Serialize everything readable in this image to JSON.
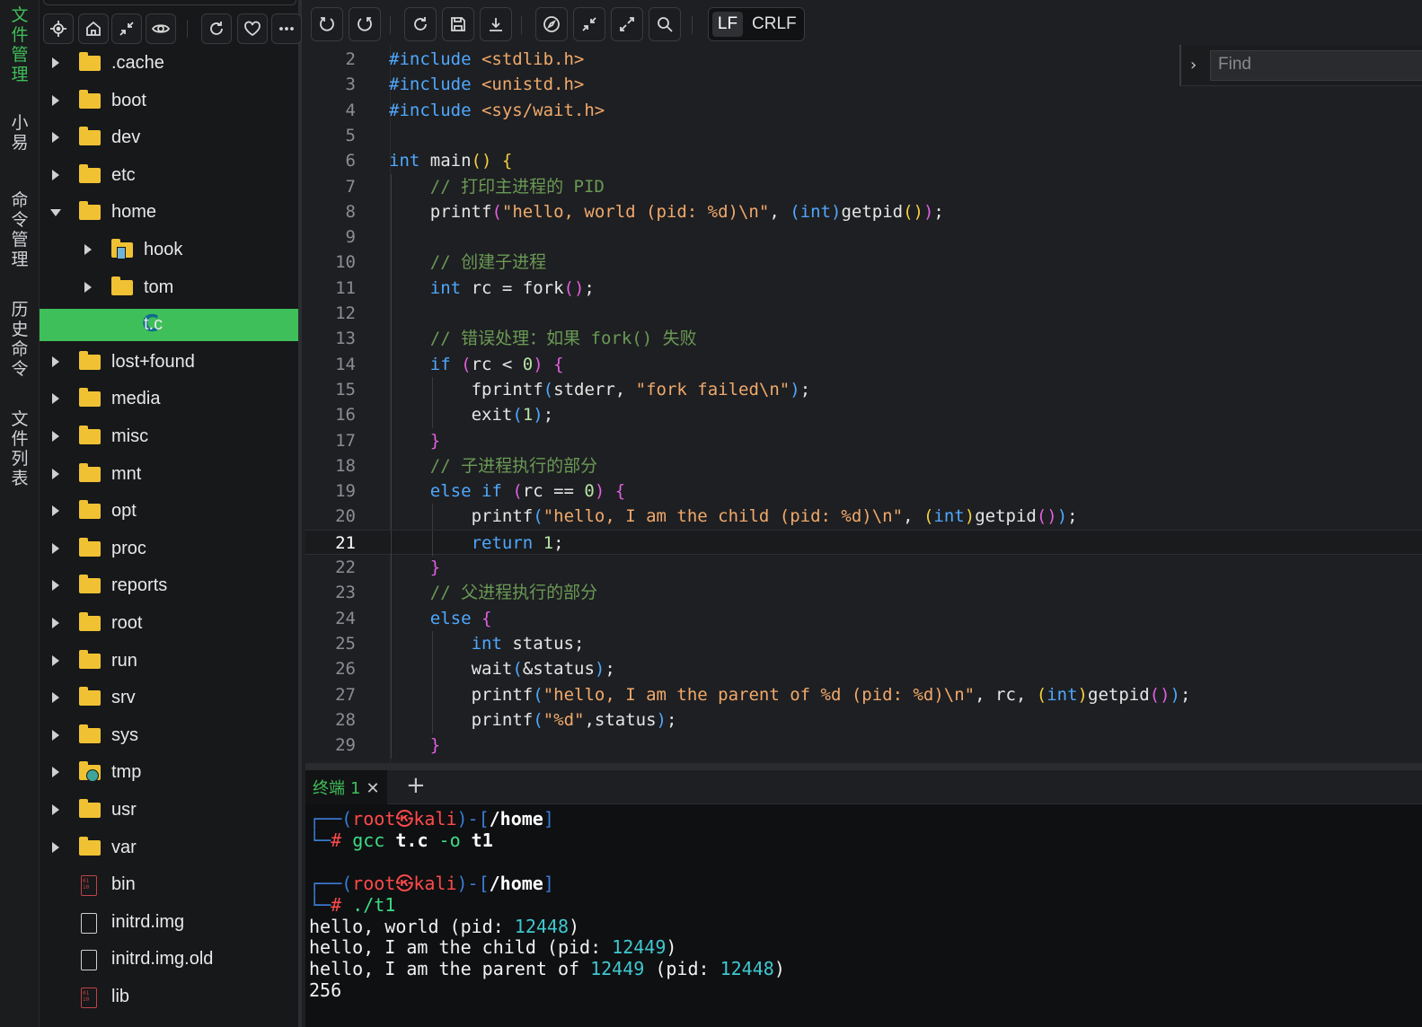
{
  "activity": [
    {
      "label": "文件管理",
      "active": true
    },
    {
      "label": "小易",
      "active": false
    },
    {
      "label": "命令管理",
      "active": false
    },
    {
      "label": "历史命令",
      "active": false
    },
    {
      "label": "文件列表",
      "active": false
    }
  ],
  "sidebar_toolbar": {
    "icons": [
      "locate-icon",
      "home-icon",
      "collapse-icon",
      "eye-icon",
      "refresh-icon",
      "heart-icon",
      "more-icon"
    ]
  },
  "tree": [
    {
      "label": ".cache",
      "type": "folder",
      "depth": 0,
      "expanded": false
    },
    {
      "label": "boot",
      "type": "folder",
      "depth": 0,
      "expanded": false
    },
    {
      "label": "dev",
      "type": "folder",
      "depth": 0,
      "expanded": false
    },
    {
      "label": "etc",
      "type": "folder",
      "depth": 0,
      "expanded": false
    },
    {
      "label": "home",
      "type": "folder",
      "depth": 0,
      "expanded": true
    },
    {
      "label": "hook",
      "type": "folder-special",
      "depth": 1,
      "expanded": false
    },
    {
      "label": "tom",
      "type": "folder",
      "depth": 1,
      "expanded": false
    },
    {
      "label": "t.c",
      "type": "c-file",
      "depth": 1,
      "selected": true
    },
    {
      "label": "lost+found",
      "type": "folder",
      "depth": 0,
      "expanded": false
    },
    {
      "label": "media",
      "type": "folder",
      "depth": 0,
      "expanded": false
    },
    {
      "label": "misc",
      "type": "folder",
      "depth": 0,
      "expanded": false
    },
    {
      "label": "mnt",
      "type": "folder",
      "depth": 0,
      "expanded": false
    },
    {
      "label": "opt",
      "type": "folder",
      "depth": 0,
      "expanded": false
    },
    {
      "label": "proc",
      "type": "folder",
      "depth": 0,
      "expanded": false
    },
    {
      "label": "reports",
      "type": "folder",
      "depth": 0,
      "expanded": false
    },
    {
      "label": "root",
      "type": "folder",
      "depth": 0,
      "expanded": false
    },
    {
      "label": "run",
      "type": "folder",
      "depth": 0,
      "expanded": false
    },
    {
      "label": "srv",
      "type": "folder",
      "depth": 0,
      "expanded": false
    },
    {
      "label": "sys",
      "type": "folder",
      "depth": 0,
      "expanded": false
    },
    {
      "label": "tmp",
      "type": "folder-tmp",
      "depth": 0,
      "expanded": false
    },
    {
      "label": "usr",
      "type": "folder",
      "depth": 0,
      "expanded": false
    },
    {
      "label": "var",
      "type": "folder",
      "depth": 0,
      "expanded": false
    },
    {
      "label": "bin",
      "type": "binary",
      "depth": 0
    },
    {
      "label": "initrd.img",
      "type": "file",
      "depth": 0
    },
    {
      "label": "initrd.img.old",
      "type": "file",
      "depth": 0
    },
    {
      "label": "lib",
      "type": "binary",
      "depth": 0
    }
  ],
  "editor_toolbar": {
    "icons": [
      "undo-icon",
      "redo-icon",
      "reload-icon",
      "save-icon",
      "download-icon",
      "compass-icon",
      "shrink-icon",
      "expand-icon",
      "search-icon"
    ],
    "eol_lf": "LF",
    "eol_crlf": "CRLF"
  },
  "find": {
    "placeholder": "Find"
  },
  "editor": {
    "current_line": 21,
    "lines": [
      {
        "n": "2",
        "indent": 0,
        "tokens": [
          [
            "pp",
            "#include "
          ],
          [
            "str",
            "<stdlib.h>"
          ]
        ]
      },
      {
        "n": "3",
        "indent": 0,
        "tokens": [
          [
            "pp",
            "#include "
          ],
          [
            "str",
            "<unistd.h>"
          ]
        ]
      },
      {
        "n": "4",
        "indent": 0,
        "tokens": [
          [
            "pp",
            "#include "
          ],
          [
            "str",
            "<sys/wait.h>"
          ]
        ]
      },
      {
        "n": "5",
        "indent": 0,
        "tokens": []
      },
      {
        "n": "6",
        "indent": 0,
        "tokens": [
          [
            "kw",
            "int "
          ],
          [
            "fn",
            "main"
          ],
          [
            "pa",
            "() {"
          ]
        ]
      },
      {
        "n": "7",
        "indent": 1,
        "tokens": [
          [
            "cm",
            "// 打印主进程的 PID"
          ]
        ]
      },
      {
        "n": "8",
        "indent": 1,
        "tokens": [
          [
            "fn",
            "printf"
          ],
          [
            "pb",
            "("
          ],
          [
            "str",
            "\"hello, world (pid: %d)\\n\""
          ],
          [
            "fn",
            ", "
          ],
          [
            "pc",
            "("
          ],
          [
            "kw",
            "int"
          ],
          [
            "pc",
            ")"
          ],
          [
            "fn",
            "getpid"
          ],
          [
            "pa",
            "()"
          ],
          [
            "pb",
            ")"
          ],
          [
            "fn",
            ";"
          ]
        ]
      },
      {
        "n": "9",
        "indent": 1,
        "tokens": []
      },
      {
        "n": "10",
        "indent": 1,
        "tokens": [
          [
            "cm",
            "// 创建子进程"
          ]
        ]
      },
      {
        "n": "11",
        "indent": 1,
        "tokens": [
          [
            "kw",
            "int "
          ],
          [
            "fn",
            "rc = fork"
          ],
          [
            "pb",
            "()"
          ],
          [
            "fn",
            ";"
          ]
        ]
      },
      {
        "n": "12",
        "indent": 1,
        "tokens": []
      },
      {
        "n": "13",
        "indent": 1,
        "tokens": [
          [
            "cm",
            "// 错误处理：如果 fork() 失败"
          ]
        ]
      },
      {
        "n": "14",
        "indent": 1,
        "tokens": [
          [
            "kw",
            "if "
          ],
          [
            "pb",
            "("
          ],
          [
            "fn",
            "rc < "
          ],
          [
            "num",
            "0"
          ],
          [
            "pb",
            ") {"
          ]
        ]
      },
      {
        "n": "15",
        "indent": 2,
        "tokens": [
          [
            "fn",
            "fprintf"
          ],
          [
            "pc",
            "("
          ],
          [
            "fn",
            "stderr, "
          ],
          [
            "str",
            "\"fork failed\\n\""
          ],
          [
            "pc",
            ")"
          ],
          [
            "fn",
            ";"
          ]
        ]
      },
      {
        "n": "16",
        "indent": 2,
        "tokens": [
          [
            "fn",
            "exit"
          ],
          [
            "pc",
            "("
          ],
          [
            "num",
            "1"
          ],
          [
            "pc",
            ")"
          ],
          [
            "fn",
            ";"
          ]
        ]
      },
      {
        "n": "17",
        "indent": 1,
        "tokens": [
          [
            "pb",
            "}"
          ]
        ]
      },
      {
        "n": "18",
        "indent": 1,
        "tokens": [
          [
            "cm",
            "// 子进程执行的部分"
          ]
        ]
      },
      {
        "n": "19",
        "indent": 1,
        "tokens": [
          [
            "kw",
            "else if "
          ],
          [
            "pb",
            "("
          ],
          [
            "fn",
            "rc == "
          ],
          [
            "num",
            "0"
          ],
          [
            "pb",
            ") {"
          ]
        ]
      },
      {
        "n": "20",
        "indent": 2,
        "tokens": [
          [
            "fn",
            "printf"
          ],
          [
            "pc",
            "("
          ],
          [
            "str",
            "\"hello, I am the child (pid: %d)\\n\""
          ],
          [
            "fn",
            ", "
          ],
          [
            "pa",
            "("
          ],
          [
            "kw",
            "int"
          ],
          [
            "pa",
            ")"
          ],
          [
            "fn",
            "getpid"
          ],
          [
            "pb",
            "()"
          ],
          [
            "pc",
            ")"
          ],
          [
            "fn",
            ";"
          ]
        ]
      },
      {
        "n": "21",
        "indent": 2,
        "tokens": [
          [
            "kw",
            "return "
          ],
          [
            "num",
            "1"
          ],
          [
            "fn",
            ";"
          ]
        ]
      },
      {
        "n": "22",
        "indent": 1,
        "tokens": [
          [
            "pb",
            "}"
          ]
        ]
      },
      {
        "n": "23",
        "indent": 1,
        "tokens": [
          [
            "cm",
            "// 父进程执行的部分"
          ]
        ]
      },
      {
        "n": "24",
        "indent": 1,
        "tokens": [
          [
            "kw",
            "else "
          ],
          [
            "pb",
            "{"
          ]
        ]
      },
      {
        "n": "25",
        "indent": 2,
        "tokens": [
          [
            "kw",
            "int "
          ],
          [
            "fn",
            "status;"
          ]
        ]
      },
      {
        "n": "26",
        "indent": 2,
        "tokens": [
          [
            "fn",
            "wait"
          ],
          [
            "pc",
            "("
          ],
          [
            "fn",
            "&status"
          ],
          [
            "pc",
            ")"
          ],
          [
            "fn",
            ";"
          ]
        ]
      },
      {
        "n": "27",
        "indent": 2,
        "tokens": [
          [
            "fn",
            "printf"
          ],
          [
            "pc",
            "("
          ],
          [
            "str",
            "\"hello, I am the parent of %d (pid: %d)\\n\""
          ],
          [
            "fn",
            ", rc, "
          ],
          [
            "pa",
            "("
          ],
          [
            "kw",
            "int"
          ],
          [
            "pa",
            ")"
          ],
          [
            "fn",
            "getpid"
          ],
          [
            "pb",
            "()"
          ],
          [
            "pc",
            ")"
          ],
          [
            "fn",
            ";"
          ]
        ]
      },
      {
        "n": "28",
        "indent": 2,
        "tokens": [
          [
            "fn",
            "printf"
          ],
          [
            "pc",
            "("
          ],
          [
            "str",
            "\"%d\""
          ],
          [
            "fn",
            ",status"
          ],
          [
            "pc",
            ")"
          ],
          [
            "fn",
            ";"
          ]
        ]
      },
      {
        "n": "29",
        "indent": 1,
        "tokens": [
          [
            "pb",
            "}"
          ]
        ]
      }
    ]
  },
  "terminal_tab": {
    "name": "终端",
    "num": "1",
    "close": "✕",
    "add": "+"
  },
  "terminal": [
    {
      "spans": [
        [
          "t-blue",
          "┌──("
        ],
        [
          "t-red",
          "root㉿kali"
        ],
        [
          "t-blue",
          ")-["
        ],
        [
          "t-white",
          "/home"
        ],
        [
          "t-blue",
          "]"
        ]
      ]
    },
    {
      "spans": [
        [
          "t-blue",
          "└─"
        ],
        [
          "t-red",
          "# "
        ],
        [
          "t-cmd",
          "gcc "
        ],
        [
          "t-bold",
          "t.c "
        ],
        [
          "t-cmd",
          "-o "
        ],
        [
          "t-bold",
          "t1"
        ]
      ]
    },
    {
      "spans": []
    },
    {
      "spans": [
        [
          "t-blue",
          "┌──("
        ],
        [
          "t-red",
          "root㉿kali"
        ],
        [
          "t-blue",
          ")-["
        ],
        [
          "t-white",
          "/home"
        ],
        [
          "t-blue",
          "]"
        ]
      ]
    },
    {
      "spans": [
        [
          "t-blue",
          "└─"
        ],
        [
          "t-red",
          "# "
        ],
        [
          "t-cmd",
          "./t1"
        ]
      ]
    },
    {
      "spans": [
        [
          "",
          "hello, world (pid: "
        ],
        [
          "t-cyan",
          "12448"
        ],
        [
          "",
          ")"
        ]
      ]
    },
    {
      "spans": [
        [
          "",
          "hello, I am the child (pid: "
        ],
        [
          "t-cyan",
          "12449"
        ],
        [
          "",
          ")"
        ]
      ]
    },
    {
      "spans": [
        [
          "",
          "hello, I am the parent of "
        ],
        [
          "t-cyan",
          "12449"
        ],
        [
          "",
          " (pid: "
        ],
        [
          "t-cyan",
          "12448"
        ],
        [
          "",
          ")"
        ]
      ]
    },
    {
      "spans": [
        [
          "",
          "256"
        ]
      ]
    }
  ]
}
